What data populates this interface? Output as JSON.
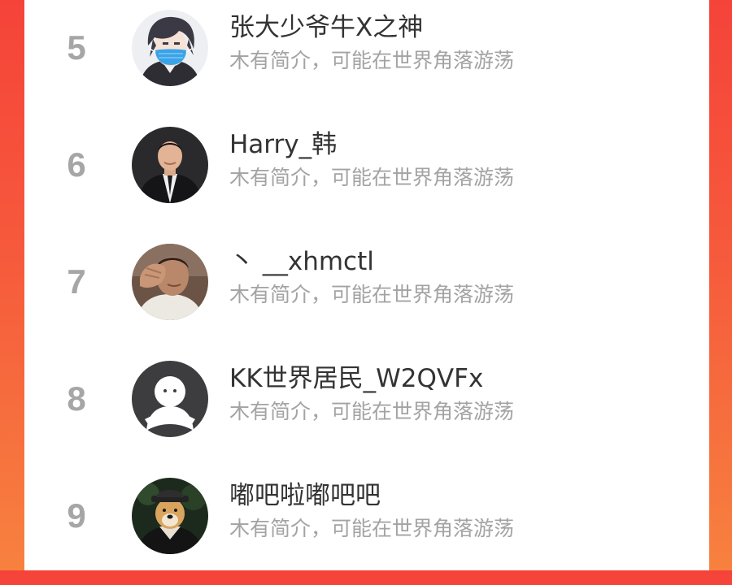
{
  "colors": {
    "background_top": "#f5433a",
    "background_bottom": "#f7813f",
    "card": "#ffffff",
    "rank": "#a6a6a6",
    "name": "#333333",
    "bio": "#a3a3a3"
  },
  "leaderboard": {
    "rows": [
      {
        "rank": "5",
        "name": "张大少爷牛X之神",
        "bio": "木有简介，可能在世界角落游荡",
        "avatar_icon": "anime-boy-mask-avatar"
      },
      {
        "rank": "6",
        "name": "Harry_韩",
        "bio": "木有简介，可能在世界角落游荡",
        "avatar_icon": "man-in-suit-avatar"
      },
      {
        "rank": "7",
        "name": "丶 __xhmctl",
        "bio": "木有简介，可能在世界角落游荡",
        "avatar_icon": "man-hand-on-face-avatar"
      },
      {
        "rank": "8",
        "name": "KK世界居民_W2QVFx",
        "bio": "木有简介，可能在世界角落游荡",
        "avatar_icon": "default-user-avatar"
      },
      {
        "rank": "9",
        "name": "嘟吧啦嘟吧吧",
        "bio": "木有简介，可能在世界角落游荡",
        "avatar_icon": "dog-in-hat-avatar"
      }
    ]
  }
}
